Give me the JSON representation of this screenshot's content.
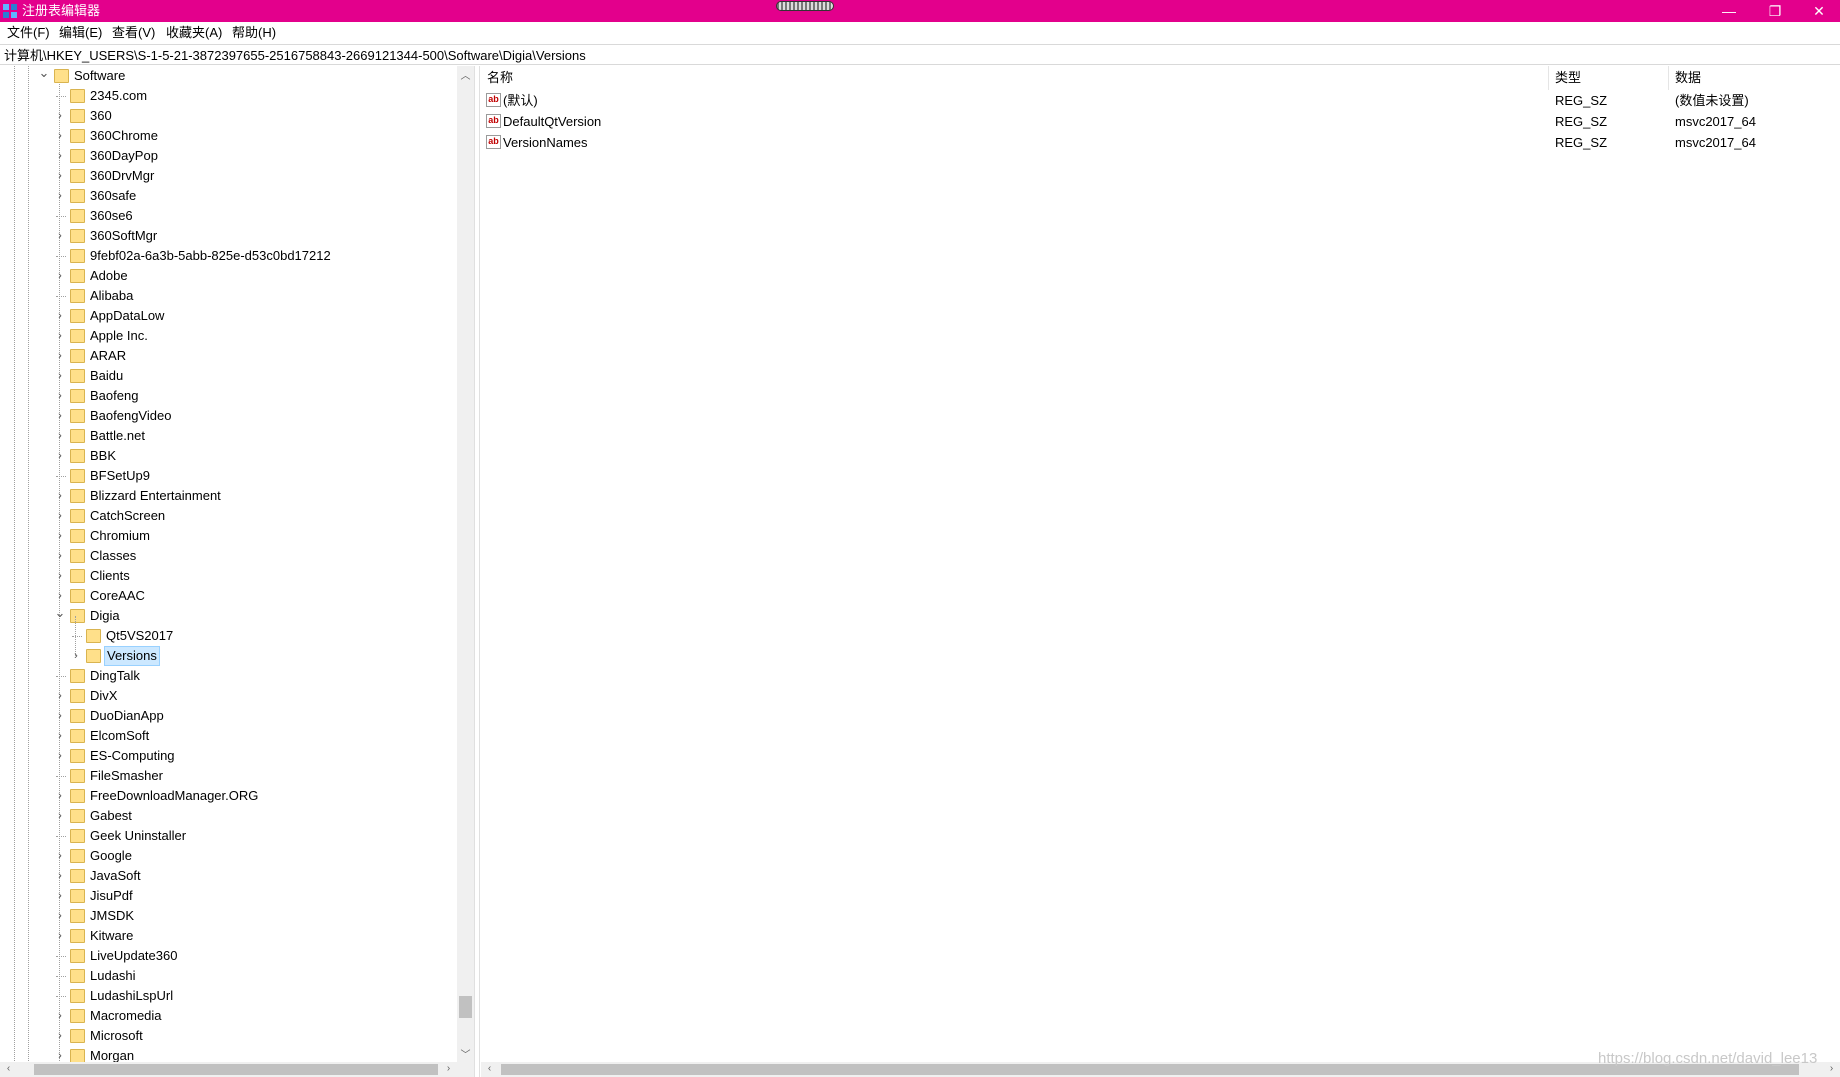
{
  "window": {
    "title": "注册表编辑器",
    "controls": {
      "minimize": "—",
      "maximize": "❐",
      "close": "✕"
    }
  },
  "menu": [
    "文件(F)",
    "编辑(E)",
    "查看(V)",
    "收藏夹(A)",
    "帮助(H)"
  ],
  "address": "计算机\\HKEY_USERS\\S-1-5-21-3872397655-2516758843-2669121344-500\\Software\\Digia\\Versions",
  "tree": {
    "root": {
      "label": "Software",
      "expanded": true
    },
    "children": [
      {
        "label": "2345.com",
        "has_children": false
      },
      {
        "label": "360",
        "has_children": true
      },
      {
        "label": "360Chrome",
        "has_children": true
      },
      {
        "label": "360DayPop",
        "has_children": true
      },
      {
        "label": "360DrvMgr",
        "has_children": true
      },
      {
        "label": "360safe",
        "has_children": true
      },
      {
        "label": "360se6",
        "has_children": false
      },
      {
        "label": "360SoftMgr",
        "has_children": true
      },
      {
        "label": "9febf02a-6a3b-5abb-825e-d53c0bd17212",
        "has_children": false
      },
      {
        "label": "Adobe",
        "has_children": true
      },
      {
        "label": "Alibaba",
        "has_children": false
      },
      {
        "label": "AppDataLow",
        "has_children": true
      },
      {
        "label": "Apple Inc.",
        "has_children": true
      },
      {
        "label": "ARAR",
        "has_children": true
      },
      {
        "label": "Baidu",
        "has_children": true
      },
      {
        "label": "Baofeng",
        "has_children": true
      },
      {
        "label": "BaofengVideo",
        "has_children": true
      },
      {
        "label": "Battle.net",
        "has_children": true
      },
      {
        "label": "BBK",
        "has_children": true
      },
      {
        "label": "BFSetUp9",
        "has_children": false
      },
      {
        "label": "Blizzard Entertainment",
        "has_children": true
      },
      {
        "label": "CatchScreen",
        "has_children": true
      },
      {
        "label": "Chromium",
        "has_children": true
      },
      {
        "label": "Classes",
        "has_children": true
      },
      {
        "label": "Clients",
        "has_children": true
      },
      {
        "label": "CoreAAC",
        "has_children": true
      },
      {
        "label": "Digia",
        "has_children": true,
        "expanded": true,
        "children": [
          {
            "label": "Qt5VS2017",
            "has_children": false
          },
          {
            "label": "Versions",
            "has_children": true,
            "selected": true
          }
        ]
      },
      {
        "label": "DingTalk",
        "has_children": false
      },
      {
        "label": "DivX",
        "has_children": true
      },
      {
        "label": "DuoDianApp",
        "has_children": true
      },
      {
        "label": "ElcomSoft",
        "has_children": true
      },
      {
        "label": "ES-Computing",
        "has_children": true
      },
      {
        "label": "FileSmasher",
        "has_children": false
      },
      {
        "label": "FreeDownloadManager.ORG",
        "has_children": true
      },
      {
        "label": "Gabest",
        "has_children": true
      },
      {
        "label": "Geek Uninstaller",
        "has_children": false
      },
      {
        "label": "Google",
        "has_children": true
      },
      {
        "label": "JavaSoft",
        "has_children": true
      },
      {
        "label": "JisuPdf",
        "has_children": true
      },
      {
        "label": "JMSDK",
        "has_children": true
      },
      {
        "label": "Kitware",
        "has_children": true
      },
      {
        "label": "LiveUpdate360",
        "has_children": false
      },
      {
        "label": "Ludashi",
        "has_children": false
      },
      {
        "label": "LudashiLspUrl",
        "has_children": false
      },
      {
        "label": "Macromedia",
        "has_children": true
      },
      {
        "label": "Microsoft",
        "has_children": true
      },
      {
        "label": "Morgan",
        "has_children": true
      }
    ]
  },
  "list": {
    "columns": [
      "名称",
      "类型",
      "数据"
    ],
    "rows": [
      {
        "icon": "ab",
        "name": "(默认)",
        "type": "REG_SZ",
        "data": "(数值未设置)"
      },
      {
        "icon": "ab",
        "name": "DefaultQtVersion",
        "type": "REG_SZ",
        "data": "msvc2017_64"
      },
      {
        "icon": "ab",
        "name": "VersionNames",
        "type": "REG_SZ",
        "data": "msvc2017_64"
      }
    ]
  },
  "watermark": "https://blog.csdn.net/david_lee13",
  "colors": {
    "titlebar": "#e3008c",
    "selection": "#cce8ff",
    "folder": "#ffe08a"
  }
}
